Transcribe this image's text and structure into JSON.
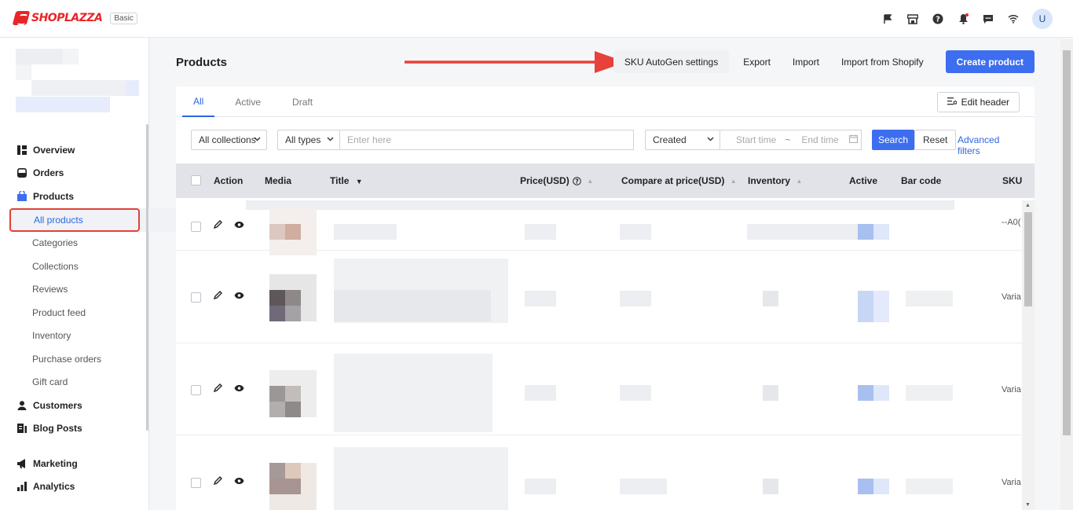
{
  "app": {
    "brand": "SHOPLAZZA",
    "plan_badge": "Basic",
    "user_initial": "U",
    "accent_color": "#3d6ef0",
    "brand_color": "#e8262a"
  },
  "topbar_icons": [
    "flag-icon",
    "store-icon",
    "help-icon",
    "bell-icon",
    "message-icon",
    "wifi-icon"
  ],
  "sidebar": {
    "items": [
      {
        "label": "Overview",
        "icon": "overview-icon"
      },
      {
        "label": "Orders",
        "icon": "orders-icon"
      },
      {
        "label": "Products",
        "icon": "products-icon"
      }
    ],
    "product_sub": [
      "All products",
      "Categories",
      "Collections",
      "Reviews",
      "Product feed",
      "Inventory",
      "Purchase orders",
      "Gift card"
    ],
    "items2": [
      {
        "label": "Customers",
        "icon": "customers-icon"
      },
      {
        "label": "Blog Posts",
        "icon": "blog-icon"
      }
    ],
    "items3": [
      {
        "label": "Marketing",
        "icon": "megaphone-icon"
      },
      {
        "label": "Analytics",
        "icon": "analytics-icon"
      }
    ]
  },
  "page": {
    "title": "Products",
    "actions": {
      "sku_autogen": "SKU AutoGen settings",
      "export": "Export",
      "import": "Import",
      "import_shopify": "Import from Shopify",
      "create": "Create product"
    }
  },
  "tabs": [
    "All",
    "Active",
    "Draft"
  ],
  "edit_header": "Edit header",
  "filters": {
    "collections": "All collections",
    "types": "All types",
    "search_placeholder": "Enter here",
    "date_field": "Created",
    "start_placeholder": "Start time",
    "separator": "~",
    "end_placeholder": "End time",
    "search_btn": "Search",
    "reset_btn": "Reset",
    "advanced": "Advanced filters"
  },
  "table": {
    "headers": {
      "action": "Action",
      "media": "Media",
      "title": "Title",
      "price": "Price(USD)",
      "compare": "Compare at price(USD)",
      "inventory": "Inventory",
      "active": "Active",
      "barcode": "Bar code",
      "sku": "SKU"
    },
    "rows": [
      {
        "sku": "--A0("
      },
      {
        "sku": "Varia"
      },
      {
        "sku": "Varia"
      },
      {
        "sku": "Varia"
      }
    ]
  }
}
